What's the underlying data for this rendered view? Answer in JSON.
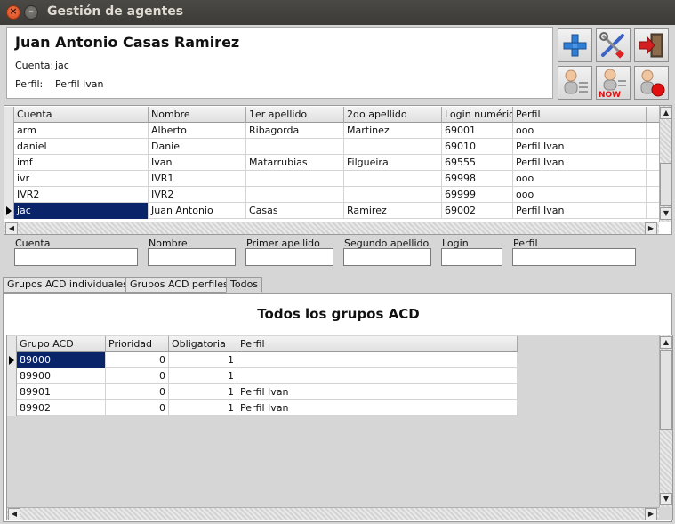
{
  "window": {
    "title": "Gestión de agentes"
  },
  "agent": {
    "full_name": "Juan Antonio Casas Ramirez",
    "account_label": "Cuenta:",
    "account_value": "jac",
    "profile_label": "Perfil:",
    "profile_value": "Perfil Ivan"
  },
  "toolbar": {
    "buttons": [
      "add-icon",
      "tools-icon",
      "exit-icon",
      "agent-list-icon",
      "agent-now-icon",
      "agent-record-icon"
    ],
    "now_badge": "NOW"
  },
  "agents_table": {
    "columns": [
      "Cuenta",
      "Nombre",
      "1er apellido",
      "2do apellido",
      "Login numéric",
      "Perfil"
    ],
    "rows": [
      [
        "arm",
        "Alberto",
        "Ribagorda",
        "Martinez",
        "69001",
        "ooo"
      ],
      [
        "daniel",
        "Daniel",
        "",
        "",
        "69010",
        "Perfil Ivan"
      ],
      [
        "imf",
        "Ivan",
        "Matarrubias",
        "Filgueira",
        "69555",
        "Perfil Ivan"
      ],
      [
        "ivr",
        "IVR1",
        "",
        "",
        "69998",
        "ooo"
      ],
      [
        "IVR2",
        "IVR2",
        "",
        "",
        "69999",
        "ooo"
      ],
      [
        "jac",
        "Juan Antonio",
        "Casas",
        "Ramirez",
        "69002",
        "Perfil Ivan"
      ]
    ],
    "selected_row": 5
  },
  "filters": {
    "labels": [
      "Cuenta",
      "Nombre",
      "Primer apellido",
      "Segundo apellido",
      "Login",
      "Perfil"
    ],
    "values": [
      "",
      "",
      "",
      "",
      "",
      ""
    ]
  },
  "tabs": {
    "items": [
      "Grupos ACD individuales",
      "Grupos ACD perfiles",
      "Todos"
    ],
    "active": 2
  },
  "groups": {
    "title": "Todos los grupos ACD",
    "columns": [
      "Grupo ACD",
      "Prioridad",
      "Obligatoria",
      "Perfil"
    ],
    "rows": [
      [
        "89000",
        "0",
        "1",
        ""
      ],
      [
        "89900",
        "0",
        "1",
        ""
      ],
      [
        "89901",
        "0",
        "1",
        "Perfil Ivan"
      ],
      [
        "89902",
        "0",
        "1",
        "Perfil Ivan"
      ]
    ],
    "selected_row": 0
  },
  "colors": {
    "selection": "#0a246a",
    "titlebar": "#3c3b37",
    "close_button": "#e5531c"
  }
}
